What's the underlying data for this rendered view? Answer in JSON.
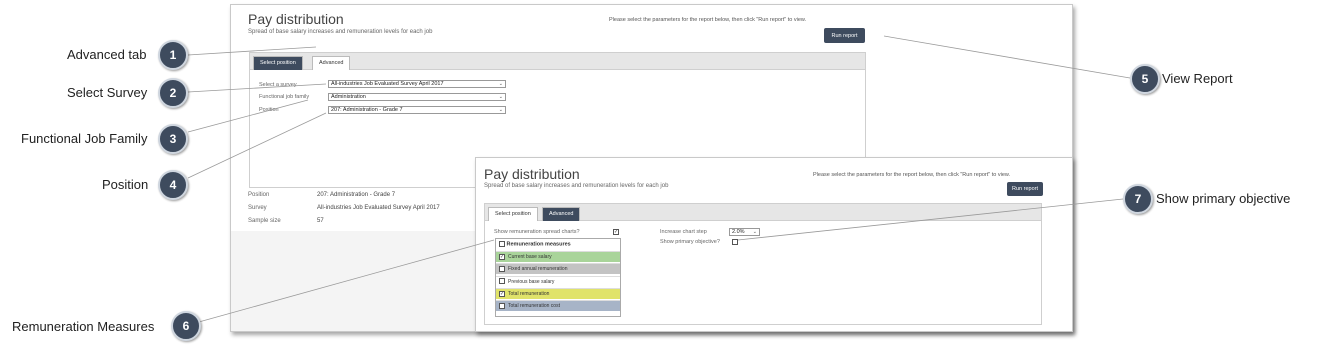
{
  "back": {
    "title": "Pay distribution",
    "subtitle": "Spread of base salary increases and remuneration levels for each job",
    "instruction": "Please select the parameters for the report below, then click \"Run report\" to view.",
    "run_label": "Run report",
    "tabs": [
      "Select position",
      "Advanced"
    ],
    "fields": {
      "survey_label": "Select a survey",
      "survey_value": "All-industries Job Evaluated Survey April 2017",
      "family_label": "Functional job family",
      "family_value": "Administration",
      "position_label": "Position",
      "position_value": "207: Administration - Grade 7"
    },
    "info": {
      "position_label": "Position",
      "position_value": "207: Administration - Grade 7",
      "survey_label": "Survey",
      "survey_value": "All-industries Job Evaluated Survey April 2017",
      "sample_label": "Sample size",
      "sample_value": "57"
    }
  },
  "front": {
    "title": "Pay distribution",
    "subtitle": "Spread of base salary increases and remuneration levels for each job",
    "instruction": "Please select the parameters for the report below, then click \"Run report\" to view.",
    "run_label": "Run report",
    "tabs": [
      "Select position",
      "Advanced"
    ],
    "show_spread_label": "Show remuneration spread charts?",
    "show_spread_checked": true,
    "increase_step_label": "Increase chart step",
    "increase_step_value": "2.0%",
    "primary_objective_label": "Show primary objective?",
    "measures_header": "Remuneration measures",
    "measures": [
      {
        "label": "Current base salary",
        "checked": true,
        "color": "#a9d49a"
      },
      {
        "label": "Fixed annual remuneration",
        "checked": false,
        "color": "#c3c3c3"
      },
      {
        "label": "Previous base salary",
        "checked": false,
        "color": "#ffffff"
      },
      {
        "label": "Total remuneration",
        "checked": true,
        "color": "#e0e36a"
      },
      {
        "label": "Total remuneration cost",
        "checked": false,
        "color": "#a7b4c7"
      }
    ]
  },
  "callouts": [
    {
      "num": "1",
      "label": "Advanced tab"
    },
    {
      "num": "2",
      "label": "Select Survey"
    },
    {
      "num": "3",
      "label": "Functional Job Family"
    },
    {
      "num": "4",
      "label": "Position"
    },
    {
      "num": "5",
      "label": "View Report"
    },
    {
      "num": "6",
      "label": "Remuneration Measures"
    },
    {
      "num": "7",
      "label": "Show primary objective"
    }
  ],
  "colors": {
    "accent": "#3e4b5e",
    "callout_ring": "#cfd6df"
  }
}
